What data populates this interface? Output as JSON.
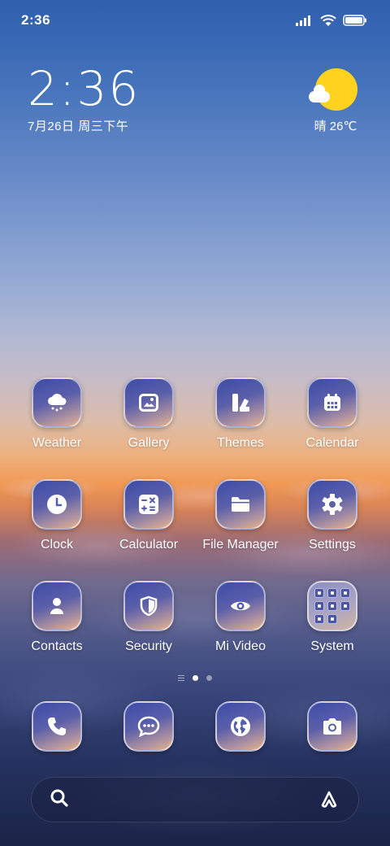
{
  "status_bar": {
    "time": "2:36",
    "icons": [
      "signal-icon",
      "wifi-icon",
      "battery-icon"
    ]
  },
  "clock_widget": {
    "time": "2:36",
    "date": "7月26日 周三下午"
  },
  "weather_widget": {
    "icon": "partly-sunny-icon",
    "text": "晴 26℃"
  },
  "apps": [
    {
      "label": "Weather",
      "icon": "weather-snow-cloud-icon"
    },
    {
      "label": "Gallery",
      "icon": "gallery-image-icon"
    },
    {
      "label": "Themes",
      "icon": "themes-brush-icon"
    },
    {
      "label": "Calendar",
      "icon": "calendar-icon"
    },
    {
      "label": "Clock",
      "icon": "clock-icon"
    },
    {
      "label": "Calculator",
      "icon": "calculator-icon"
    },
    {
      "label": "File Manager",
      "icon": "folder-icon"
    },
    {
      "label": "Settings",
      "icon": "gear-icon"
    },
    {
      "label": "Contacts",
      "icon": "person-icon"
    },
    {
      "label": "Security",
      "icon": "shield-icon"
    },
    {
      "label": "Mi Video",
      "icon": "eye-icon"
    },
    {
      "label": "System",
      "icon": "folder-grid-icon"
    }
  ],
  "page_indicator": {
    "pages": 2,
    "active": 1
  },
  "dock": [
    {
      "icon": "phone-icon"
    },
    {
      "icon": "message-icon"
    },
    {
      "icon": "browser-globe-icon"
    },
    {
      "icon": "camera-icon"
    }
  ],
  "search_bar": {
    "left_icon": "search-icon",
    "right_icon": "assistant-icon"
  },
  "colors": {
    "icon_gradient_top": "#3d4ca8",
    "icon_gradient_bottom": "#e7b38c",
    "sun": "#ffd21f"
  }
}
